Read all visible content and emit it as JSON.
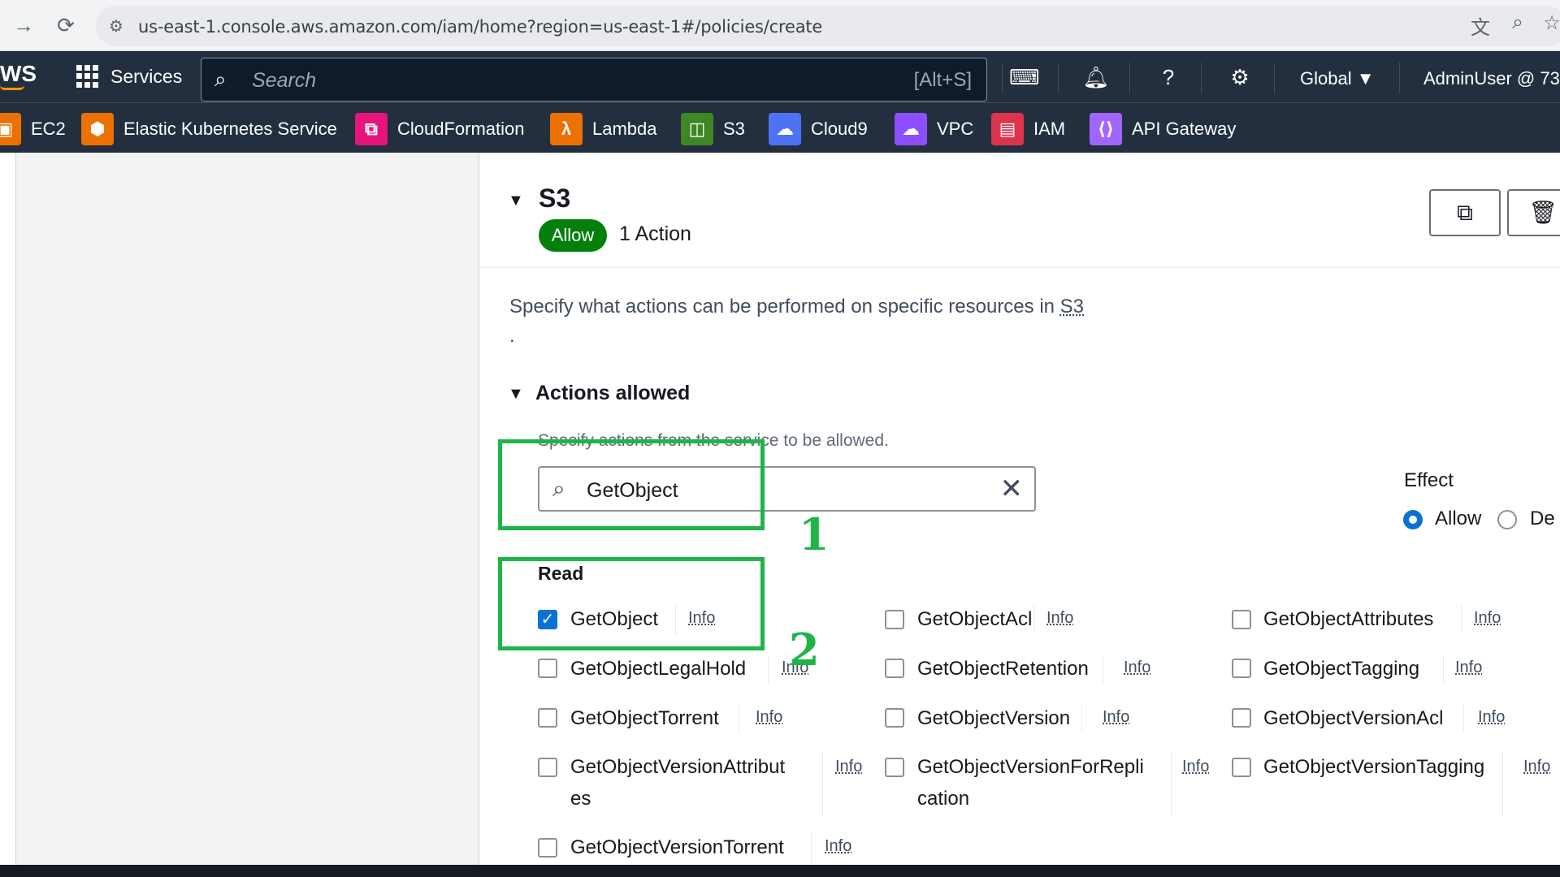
{
  "browser": {
    "back_icon": "→",
    "reload_icon": "⟳",
    "url": "us-east-1.console.aws.amazon.com/iam/home?region=us-east-1#/policies/create"
  },
  "aws_nav": {
    "logo": "WS",
    "services_label": "Services",
    "search_placeholder": "Search",
    "search_shortcut": "[Alt+S]",
    "region_label": "Global ▼",
    "account_label": "AdminUser @ 73"
  },
  "favorites": [
    {
      "label": "EC2",
      "color": "#ed7100"
    },
    {
      "label": "Elastic Kubernetes Service",
      "color": "#ed7100"
    },
    {
      "label": "CloudFormation",
      "color": "#e7157b"
    },
    {
      "label": "Lambda",
      "color": "#ed7100"
    },
    {
      "label": "S3",
      "color": "#3f8624"
    },
    {
      "label": "Cloud9",
      "color": "#4d72f3"
    },
    {
      "label": "VPC",
      "color": "#8c4fff"
    },
    {
      "label": "IAM",
      "color": "#dd344c"
    },
    {
      "label": "API Gateway",
      "color": "#a166ff"
    }
  ],
  "service_block": {
    "title": "S3",
    "effect_badge": "Allow",
    "action_count": "1 Action",
    "description": "Specify what actions can be performed on specific resources in ",
    "description_link": "S3",
    "description_dot": "."
  },
  "actions_allowed": {
    "title": "Actions allowed",
    "hint": "Specify actions from the service to be allowed.",
    "filter_value": "GetObject",
    "effect_label": "Effect",
    "effect_options": [
      "Allow",
      "Deny"
    ],
    "effect_visible_options": [
      "Allow",
      "De"
    ],
    "effect_selected": "Allow"
  },
  "read_group": {
    "label": "Read",
    "info_label": "Info",
    "actions": [
      {
        "name": "GetObject",
        "checked": true
      },
      {
        "name": "GetObjectAcl",
        "checked": false
      },
      {
        "name": "GetObjectAttributes",
        "checked": false
      },
      {
        "name": "GetObjectLegalHold",
        "checked": false
      },
      {
        "name": "GetObjectRetention",
        "checked": false
      },
      {
        "name": "GetObjectTagging",
        "checked": false
      },
      {
        "name": "GetObjectTorrent",
        "checked": false
      },
      {
        "name": "GetObjectVersion",
        "checked": false
      },
      {
        "name": "GetObjectVersionAcl",
        "checked": false
      },
      {
        "name": "GetObjectVersionAttributes",
        "display": "GetObjectVersionAttribut\nes",
        "checked": false
      },
      {
        "name": "GetObjectVersionForReplication",
        "display": "GetObjectVersionForRepli\ncation",
        "checked": false
      },
      {
        "name": "GetObjectVersionTagging",
        "checked": false
      },
      {
        "name": "GetObjectVersionTorrent",
        "checked": false
      }
    ]
  },
  "annotations": {
    "step1": "1",
    "step2": "2",
    "highlight_color": "#1fb44a"
  },
  "colors": {
    "nav_bg": "#232f3e",
    "allow_badge": "#037f0c",
    "checkbox_checked": "#0972d3"
  }
}
